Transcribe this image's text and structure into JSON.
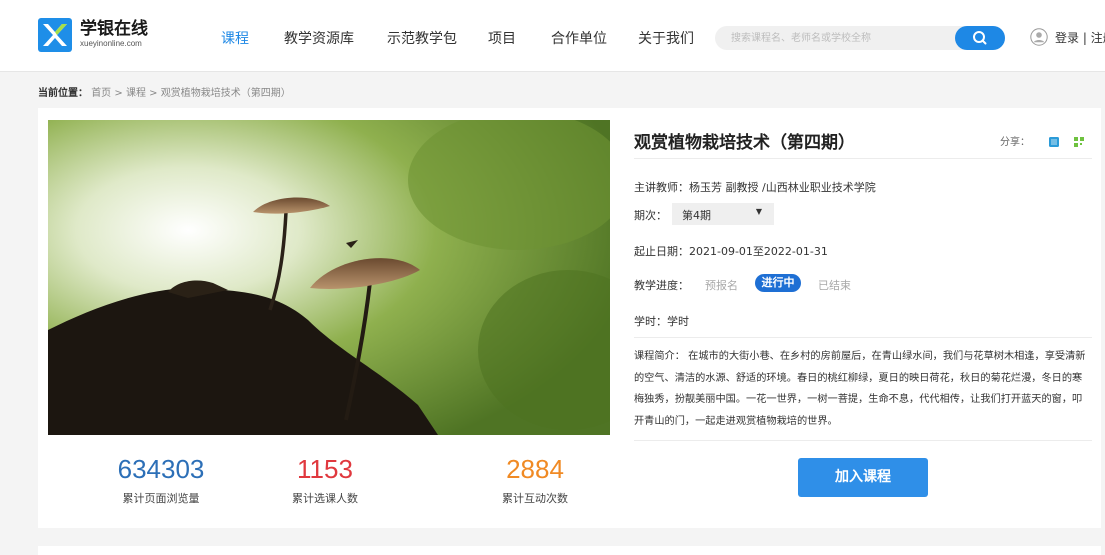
{
  "brand": {
    "name": "学银在线",
    "domain": "xueyinonline.com",
    "color": "#1e8ee8"
  },
  "nav": {
    "items": [
      {
        "label": "课程",
        "active": true
      },
      {
        "label": "教学资源库",
        "active": false
      },
      {
        "label": "示范教学包",
        "active": false
      },
      {
        "label": "项目",
        "active": false
      },
      {
        "label": "合作单位",
        "active": false
      },
      {
        "label": "关于我们",
        "active": false
      }
    ]
  },
  "search": {
    "placeholder": "搜索课程名、老师名或学校全称",
    "button_icon": "search-icon"
  },
  "account": {
    "login": "登录",
    "separator": "|",
    "register": "注册"
  },
  "breadcrumb": {
    "label": "当前位置：",
    "home": "首页",
    "sep1": ">",
    "category": "课程",
    "sep2": ">",
    "current": "观赏植物栽培技术（第四期）"
  },
  "course": {
    "title": "观赏植物栽培技术（第四期）",
    "share_label": "分享：",
    "share_icons": [
      "qq-space-icon",
      "wechat-qr-icon"
    ],
    "teacher": "主讲教师：杨玉芳 副教授 /山西林业职业技术学院",
    "term_label": "期次：",
    "term_value": "第4期",
    "dates": "起止日期：2021-09-01至2022-01-31",
    "progress_label": "教学进度：",
    "progress_steps": [
      {
        "label": "预报名",
        "state": "inactive"
      },
      {
        "label": "进行中",
        "state": "active"
      },
      {
        "label": "已结束",
        "state": "inactive"
      }
    ],
    "hours": "学时：学时",
    "intro": "课程简介： 在城市的大街小巷、在乡村的房前屋后，在青山绿水间，我们与花草树木相逢，享受清新的空气、清洁的水源、舒适的环境。春日的桃红柳绿，夏日的映日荷花，秋日的菊花烂漫，冬日的寒梅独秀，扮靓美丽中国。一花一世界，一树一菩提，生命不息，代代相传，让我们打开蓝天的窗，叩开青山的门，一起走进观赏植物栽培的世界。",
    "join_button": "加入课程",
    "accent_color": "#1e6fd4"
  },
  "stats": [
    {
      "value": "634303",
      "label": "累计页面浏览量",
      "color": "#2c6fb7"
    },
    {
      "value": "1153",
      "label": "累计选课人数",
      "color": "#e0383e"
    },
    {
      "value": "2884",
      "label": "累计互动次数",
      "color": "#f08a24"
    }
  ]
}
